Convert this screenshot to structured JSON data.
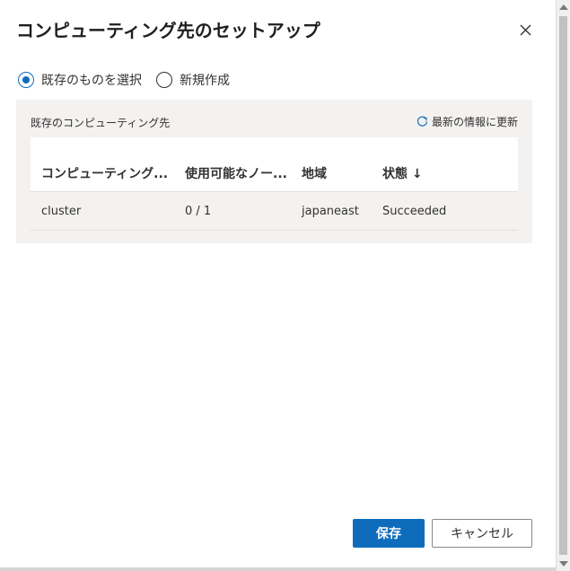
{
  "dialog": {
    "title": "コンピューティング先のセットアップ",
    "close_icon": "close-icon"
  },
  "radio": {
    "options": [
      {
        "label": "既存のものを選択",
        "checked": true
      },
      {
        "label": "新規作成",
        "checked": false
      }
    ]
  },
  "panel": {
    "title": "既存のコンピューティング先",
    "refresh_label": "最新の情報に更新",
    "refresh_icon": "refresh-icon"
  },
  "table": {
    "headers": [
      "コンピューティング...",
      "使用可能なノー...",
      "地域",
      "状態 ↓"
    ],
    "rows": [
      [
        "cluster",
        "0 / 1",
        "japaneast",
        "Succeeded"
      ]
    ]
  },
  "footer": {
    "save_label": "保存",
    "cancel_label": "キャンセル"
  },
  "colors": {
    "accent": "#0f6cbd",
    "panel_bg": "#f3f2f1"
  }
}
